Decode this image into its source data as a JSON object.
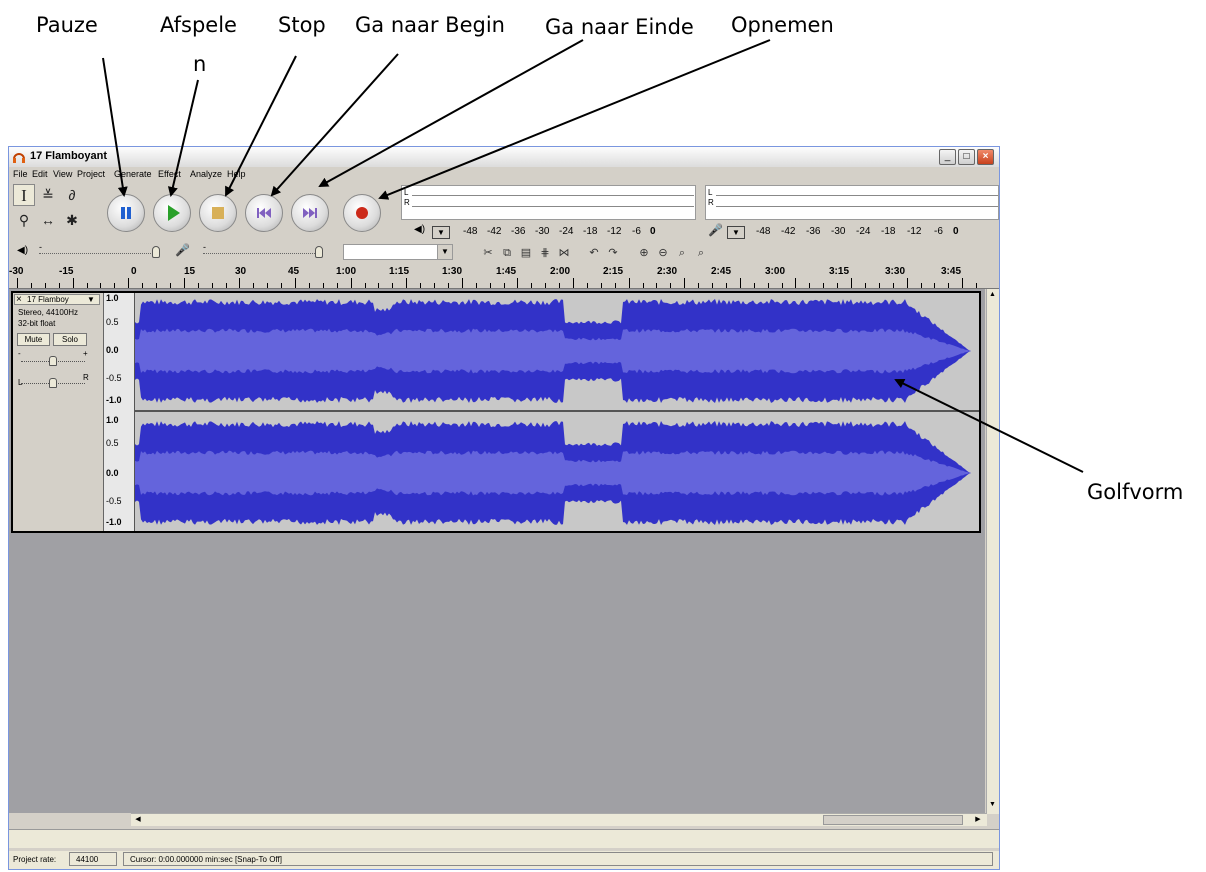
{
  "callouts": {
    "pauze": "Pauze",
    "afspelen_line1": "Afspele",
    "afspelen_line2": "n",
    "stop": "Stop",
    "ga_naar_begin": "Ga naar Begin",
    "ga_naar_einde": "Ga naar Einde",
    "opnemen": "Opnemen",
    "golfvorm": "Golfvorm"
  },
  "window": {
    "title": "17 Flamboyant",
    "minimize_glyph": "_",
    "maximize_glyph": "□",
    "close_glyph": "×"
  },
  "menu": [
    "File",
    "Edit",
    "View",
    "Project",
    "Generate",
    "Effect",
    "Analyze",
    "Help"
  ],
  "tools": {
    "selection": "I",
    "envelope": "≚",
    "draw": "∂",
    "zoom": "⚲",
    "timeshift": "↔",
    "multi": "✱"
  },
  "transport": [
    "pause",
    "play",
    "stop",
    "skip-start",
    "skip-end",
    "record"
  ],
  "meters": {
    "left_label": "L",
    "right_label": "R",
    "scale": [
      "-48",
      "-42",
      "-36",
      "-30",
      "-24",
      "-18",
      "-12",
      "-6",
      "0"
    ]
  },
  "mixer": {
    "volume_icon": "◀)",
    "mic_icon": "🎤",
    "minus": "-"
  },
  "timeline": [
    "-30",
    "-15",
    "0",
    "15",
    "30",
    "45",
    "1:00",
    "1:15",
    "1:30",
    "1:45",
    "2:00",
    "2:15",
    "2:30",
    "2:45",
    "3:00",
    "3:15",
    "3:30",
    "3:45"
  ],
  "track": {
    "name": "17 Flamboy",
    "close": "×",
    "menu_arrow": "▼",
    "format_rate": "Stereo, 44100Hz",
    "format_bits": "32-bit float",
    "mute_label": "Mute",
    "solo_label": "Solo",
    "gain_minus": "-",
    "gain_plus": "+",
    "pan_left": "L",
    "pan_right": "R",
    "scale": [
      "1.0",
      "0.5",
      "0.0",
      "-0.5",
      "-1.0"
    ]
  },
  "status": {
    "project_rate_label": "Project rate:",
    "project_rate_value": "44100",
    "cursor_text": "Cursor: 0:00.000000 min:sec  [Snap-To Off]"
  },
  "colors": {
    "waveform": "#3232c8",
    "waveform_rms": "#6464dc",
    "track_bg": "#c8c8c8",
    "record": "#cc2a1a",
    "play": "#2aa02a"
  }
}
